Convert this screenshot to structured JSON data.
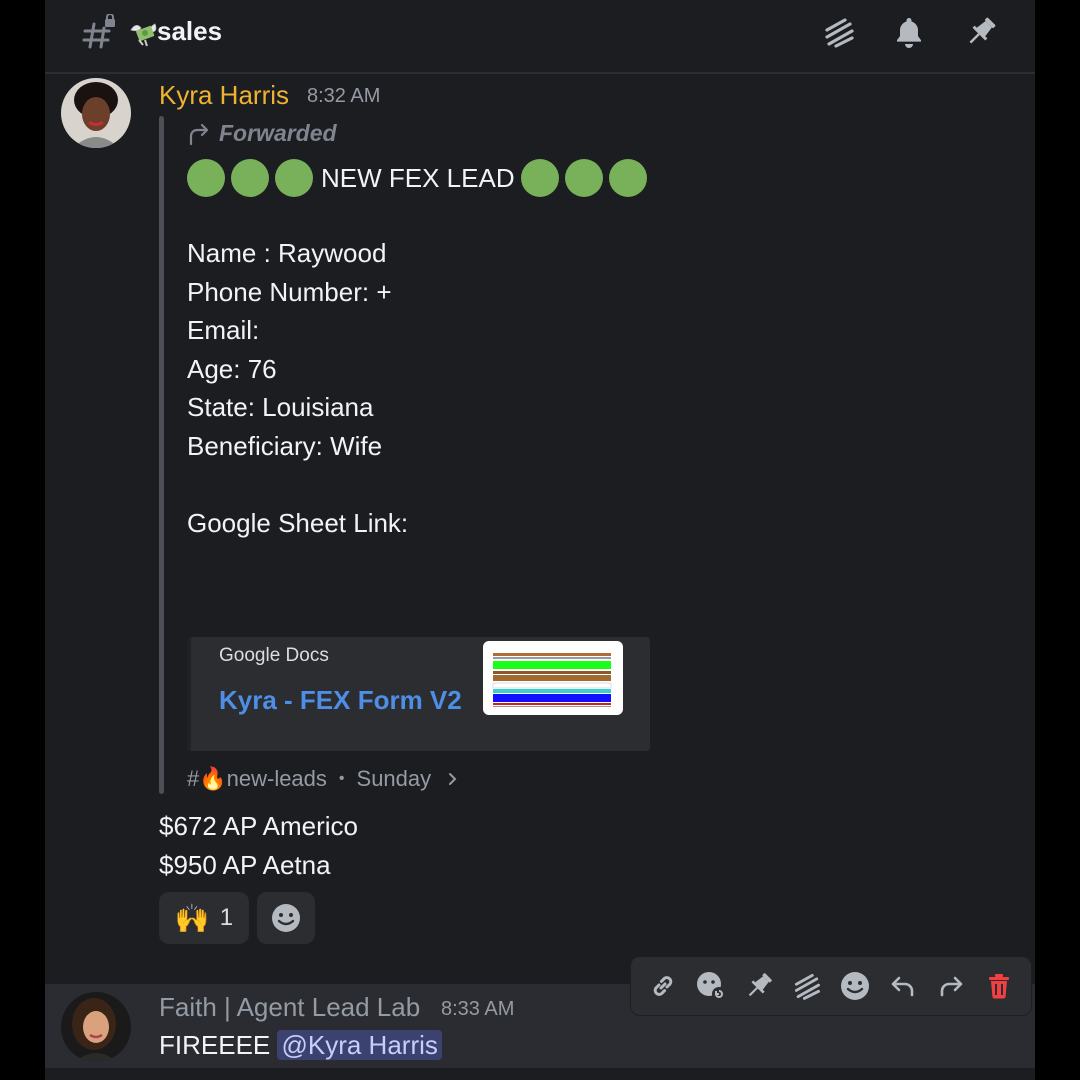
{
  "header": {
    "channel_name": "sales",
    "channel_emoji": "money-with-wings-icon",
    "icons": [
      "threads-icon",
      "bell-icon",
      "pin-icon"
    ]
  },
  "message1": {
    "username": "Kyra Harris",
    "username_color": "#f0b232",
    "timestamp": "8:32 AM",
    "forwarded_label": "Forwarded",
    "lead_title": "NEW FEX LEAD",
    "fields": [
      "Name : Raywood",
      "Phone Number: +",
      "Email:",
      "Age: 76",
      "State: Louisiana",
      "Beneficiary: Wife",
      "",
      "Google Sheet Link:"
    ],
    "embed": {
      "provider": "Google Docs",
      "title": "Kyra - FEX Form V2",
      "title_color": "#4e8ee6"
    },
    "origin": {
      "channel": "#🔥new-leads",
      "separator": "•",
      "day": "Sunday"
    },
    "body": [
      "$672 AP Americo",
      "$950 AP Aetna"
    ],
    "reactions": [
      {
        "emoji": "🙌",
        "count": "1"
      }
    ]
  },
  "message2": {
    "username": "Faith | Agent Lead Lab",
    "username_color": "#949ba4",
    "timestamp": "8:33 AM",
    "text": "FIREEEE",
    "mention": "@Kyra Harris"
  },
  "toolbar": {
    "buttons": [
      "link-icon",
      "super-reaction-icon",
      "pin-icon",
      "thread-icon",
      "add-reaction-icon",
      "reply-icon",
      "forward-icon",
      "delete-icon"
    ]
  },
  "colors": {
    "background": "#1c1d21",
    "lead_dot": "#78b159",
    "delete": "#f23f42"
  }
}
